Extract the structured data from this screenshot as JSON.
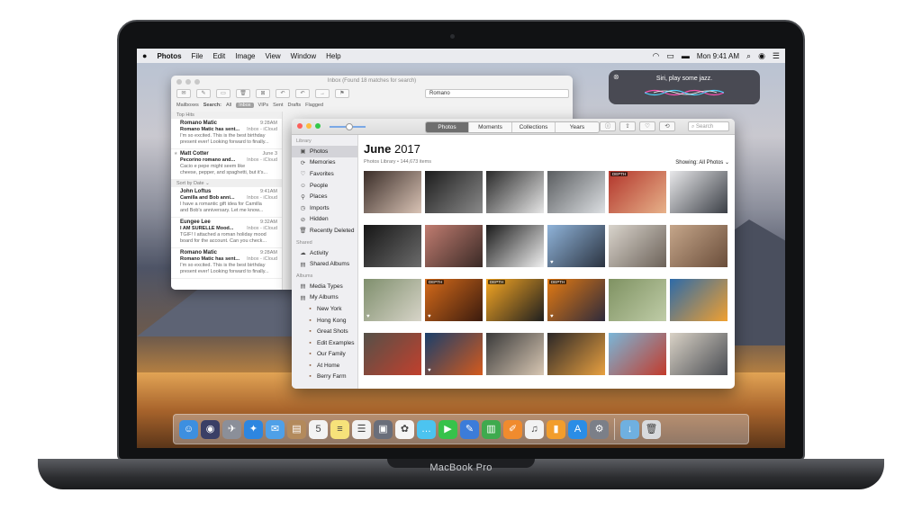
{
  "device": {
    "brand": "MacBook Pro"
  },
  "menubar": {
    "apple": "",
    "app": "Photos",
    "menus": [
      "File",
      "Edit",
      "Image",
      "View",
      "Window",
      "Help"
    ],
    "clock": "Mon 9:41 AM",
    "icons": [
      "wifi-icon",
      "airplay-icon",
      "battery-icon",
      "spotlight-icon",
      "siri-icon",
      "notification-center-icon"
    ]
  },
  "siri": {
    "prompt": "Siri, play some jazz."
  },
  "mail": {
    "title": "Inbox (Found 18 matches for search)",
    "search_value": "Romano",
    "filter": {
      "mailboxes": "Mailboxes",
      "search_label": "Search:",
      "all": "All",
      "inbox": "Inbox",
      "vips": "VIPs",
      "sent": "Sent",
      "drafts": "Drafts",
      "flagged": "Flagged"
    },
    "top_hits_header": "Top Hits",
    "sort_header": "Sort by Date",
    "top_hits": [
      {
        "from": "Romano Matic",
        "time": "9:28AM",
        "subject": "Romano Matic has sent...",
        "mailbox": "Inbox - iCloud",
        "preview1": "I'm so excited. This is the best birthday",
        "preview2": "present ever! Looking forward to finally..."
      },
      {
        "from": "Matt Cotter",
        "time": "June 3",
        "subject": "Pecorino romano and...",
        "mailbox": "Inbox - iCloud",
        "preview1": "Cacio e pepe might seem like",
        "preview2": "cheese, pepper, and spaghetti, but it's..."
      }
    ],
    "messages": [
      {
        "from": "John Loftus",
        "time": "9:41AM",
        "subject": "Camilla and Bob anni...",
        "mailbox": "Inbox - iCloud",
        "preview1": "I have a romantic gift idea for Camilla",
        "preview2": "and Bob's anniversary. Let me know..."
      },
      {
        "from": "Eungee Lee",
        "time": "9:32AM",
        "subject": "I AM SURELLE Mood...",
        "mailbox": "Inbox - iCloud",
        "preview1": "TGIF! I attached a roman holiday mood",
        "preview2": "board for the account. Can you check..."
      },
      {
        "from": "Romano Matic",
        "time": "9:28AM",
        "subject": "Romano Matic has sent...",
        "mailbox": "Inbox - iCloud",
        "preview1": "I'm so excited. This is the best birthday",
        "preview2": "present ever! Looking forward to finally..."
      }
    ]
  },
  "photos": {
    "tabs": [
      {
        "label": "Photos",
        "active": true
      },
      {
        "label": "Moments",
        "active": false
      },
      {
        "label": "Collections",
        "active": false
      },
      {
        "label": "Years",
        "active": false
      }
    ],
    "search_placeholder": "Search",
    "sidebar": {
      "library_header": "Library",
      "library": [
        {
          "label": "Photos",
          "icon": "photos-icon",
          "selected": true
        },
        {
          "label": "Memories",
          "icon": "memories-icon"
        },
        {
          "label": "Favorites",
          "icon": "heart-icon"
        },
        {
          "label": "People",
          "icon": "person-icon"
        },
        {
          "label": "Places",
          "icon": "pin-icon"
        },
        {
          "label": "Imports",
          "icon": "clock-icon"
        },
        {
          "label": "Hidden",
          "icon": "hidden-icon"
        },
        {
          "label": "Recently Deleted",
          "icon": "trash-icon"
        }
      ],
      "shared_header": "Shared",
      "shared": [
        {
          "label": "Activity",
          "icon": "cloud-icon"
        },
        {
          "label": "Shared Albums",
          "icon": "folder-icon"
        }
      ],
      "albums_header": "Albums",
      "albums": [
        {
          "label": "Media Types",
          "icon": "folder-icon"
        },
        {
          "label": "My Albums",
          "icon": "folder-icon"
        },
        {
          "label": "New York",
          "icon": "album-thumb-icon"
        },
        {
          "label": "Hong Kong",
          "icon": "album-thumb-icon"
        },
        {
          "label": "Great Shots",
          "icon": "album-thumb-icon"
        },
        {
          "label": "Edit Examples",
          "icon": "album-thumb-icon"
        },
        {
          "label": "Our Family",
          "icon": "album-thumb-icon"
        },
        {
          "label": "At Home",
          "icon": "album-thumb-icon"
        },
        {
          "label": "Berry Farm",
          "icon": "album-thumb-icon"
        }
      ]
    },
    "month_bold": "June",
    "year": "2017",
    "library_count": "Photos Library • 144,673 items",
    "showing": "Showing: All Photos",
    "depth_label": "DEPTH",
    "tiles": [
      {
        "colors": [
          "#3a2d28",
          "#d9c3b5"
        ],
        "depth": false,
        "heart": false
      },
      {
        "colors": [
          "#1c1c1c",
          "#8a8a8a"
        ],
        "depth": false,
        "heart": false
      },
      {
        "colors": [
          "#2a2a2a",
          "#e6e6e6"
        ],
        "depth": false,
        "heart": false
      },
      {
        "colors": [
          "#5a5d60",
          "#dcdfe2"
        ],
        "depth": false,
        "heart": false
      },
      {
        "colors": [
          "#b2352b",
          "#e7b28a"
        ],
        "depth": true,
        "heart": false
      },
      {
        "colors": [
          "#e8e8ea",
          "#3b3f46"
        ],
        "depth": false,
        "heart": false
      },
      {
        "colors": [
          "#161616",
          "#6b6b6b"
        ],
        "depth": false,
        "heart": false
      },
      {
        "colors": [
          "#c07c70",
          "#3a2a26"
        ],
        "depth": false,
        "heart": false
      },
      {
        "colors": [
          "#1a1a1a",
          "#f0f0f0"
        ],
        "depth": false,
        "heart": false
      },
      {
        "colors": [
          "#8fb3d9",
          "#2b3340"
        ],
        "depth": false,
        "heart": true
      },
      {
        "colors": [
          "#d9d4cc",
          "#6c6259"
        ],
        "depth": false,
        "heart": false
      },
      {
        "colors": [
          "#c5a68a",
          "#6a4d3a"
        ],
        "depth": false,
        "heart": false
      },
      {
        "colors": [
          "#7f8f6d",
          "#d7d4c8"
        ],
        "depth": false,
        "heart": true
      },
      {
        "colors": [
          "#d56b1a",
          "#3b1b0e"
        ],
        "depth": true,
        "heart": true
      },
      {
        "colors": [
          "#f5a623",
          "#1f1f1f"
        ],
        "depth": true,
        "heart": false
      },
      {
        "colors": [
          "#e37a12",
          "#2e2a3b"
        ],
        "depth": true,
        "heart": true
      },
      {
        "colors": [
          "#7f9262",
          "#bfcca7"
        ],
        "depth": false,
        "heart": false
      },
      {
        "colors": [
          "#2d6aa8",
          "#f0a030"
        ],
        "depth": false,
        "heart": false
      },
      {
        "colors": [
          "#555048",
          "#c2402d"
        ],
        "depth": false,
        "heart": false
      },
      {
        "colors": [
          "#1a3f6b",
          "#d45a1d"
        ],
        "depth": false,
        "heart": true
      },
      {
        "colors": [
          "#3a3a3a",
          "#d8c7b3"
        ],
        "depth": false,
        "heart": false
      },
      {
        "colors": [
          "#2b2727",
          "#e8a040"
        ],
        "depth": false,
        "heart": false
      },
      {
        "colors": [
          "#7ab6d8",
          "#c23b2c"
        ],
        "depth": false,
        "heart": false
      },
      {
        "colors": [
          "#d9d2c6",
          "#494c52"
        ],
        "depth": false,
        "heart": false
      }
    ]
  },
  "dock": [
    {
      "name": "finder-icon",
      "bg": "#3d8fe0",
      "glyph": "☺"
    },
    {
      "name": "siri-app-icon",
      "bg": "#3a3f66",
      "glyph": "◉"
    },
    {
      "name": "launchpad-icon",
      "bg": "#8b8f99",
      "glyph": "✈"
    },
    {
      "name": "safari-icon",
      "bg": "#2d86e0",
      "glyph": "✦"
    },
    {
      "name": "mail-icon",
      "bg": "#4fa0e8",
      "glyph": "✉"
    },
    {
      "name": "contacts-icon",
      "bg": "#b38a5c",
      "glyph": "▤"
    },
    {
      "name": "calendar-icon",
      "bg": "#f3f3f3",
      "glyph": "5"
    },
    {
      "name": "notes-icon",
      "bg": "#f6e27a",
      "glyph": "≡"
    },
    {
      "name": "reminders-icon",
      "bg": "#f2f2f2",
      "glyph": "☰"
    },
    {
      "name": "photo-booth-icon",
      "bg": "#6a6e7a",
      "glyph": "▣"
    },
    {
      "name": "photos-app-icon",
      "bg": "#f5f5f5",
      "glyph": "✿"
    },
    {
      "name": "messages-icon",
      "bg": "#4cc4f0",
      "glyph": "…"
    },
    {
      "name": "facetime-icon",
      "bg": "#37c24a",
      "glyph": "▶"
    },
    {
      "name": "keynote-icon",
      "bg": "#3c7cd9",
      "glyph": "✎"
    },
    {
      "name": "numbers-icon",
      "bg": "#3eaa4e",
      "glyph": "▥"
    },
    {
      "name": "pages-icon",
      "bg": "#f08b2e",
      "glyph": "✐"
    },
    {
      "name": "itunes-icon",
      "bg": "#f2f2f2",
      "glyph": "♫"
    },
    {
      "name": "ibooks-icon",
      "bg": "#f29d2c",
      "glyph": "▮"
    },
    {
      "name": "app-store-icon",
      "bg": "#2a8de6",
      "glyph": "A"
    },
    {
      "name": "system-preferences-icon",
      "bg": "#7b7f88",
      "glyph": "⚙"
    },
    {
      "name": "downloads-folder-icon",
      "bg": "#6fb0e0",
      "glyph": "↓"
    },
    {
      "name": "trash-icon",
      "bg": "#d8dadd",
      "glyph": "🗑"
    }
  ]
}
